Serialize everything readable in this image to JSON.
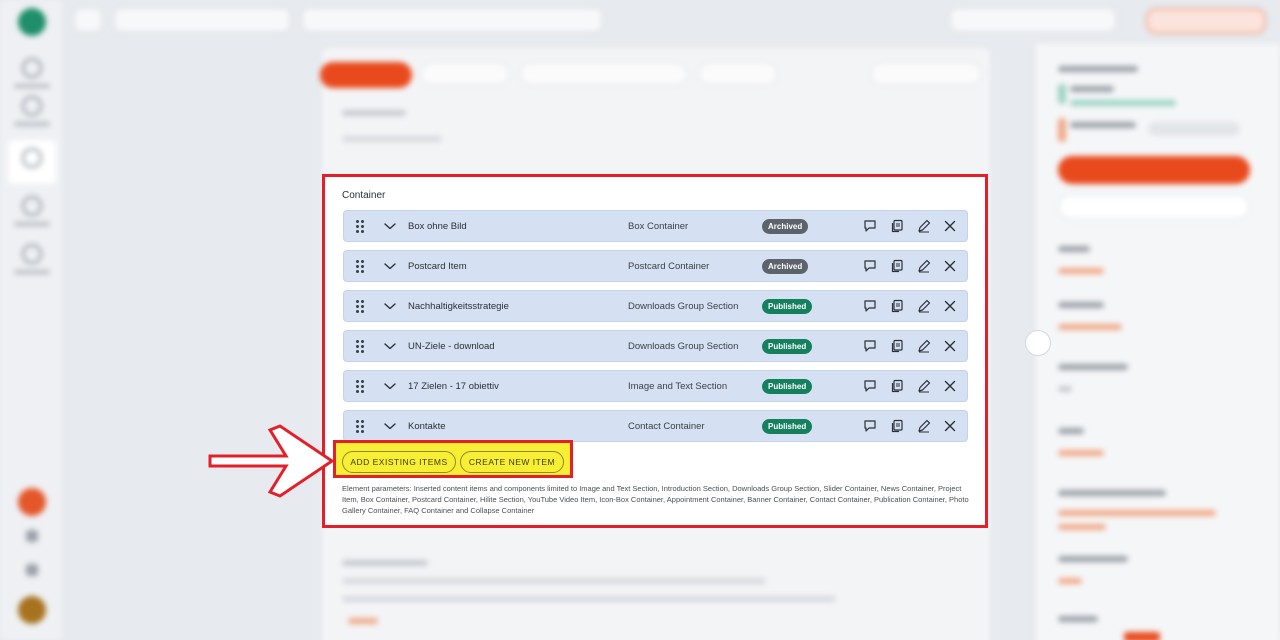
{
  "container": {
    "title": "Container",
    "items": [
      {
        "name": "Box ohne Bild",
        "type": "Box Container",
        "status": "Archived",
        "status_kind": "archived"
      },
      {
        "name": "Postcard Item",
        "type": "Postcard Container",
        "status": "Archived",
        "status_kind": "archived"
      },
      {
        "name": "Nachhaltigkeitsstrategie",
        "type": "Downloads Group Section",
        "status": "Published",
        "status_kind": "published"
      },
      {
        "name": "UN-Ziele - download",
        "type": "Downloads Group Section",
        "status": "Published",
        "status_kind": "published"
      },
      {
        "name": "17 Zielen - 17 obiettiv",
        "type": "Image and Text Section",
        "status": "Published",
        "status_kind": "published"
      },
      {
        "name": "Kontakte",
        "type": "Contact Container",
        "status": "Published",
        "status_kind": "published"
      }
    ],
    "row_actions": [
      "comment-icon",
      "copy-icon",
      "edit-icon",
      "close-icon"
    ],
    "buttons": {
      "add_existing": "ADD EXISTING ITEMS",
      "create_new": "CREATE NEW ITEM"
    },
    "element_parameters": "Element parameters: Inserted content items and components limited to Image and Text Section, Introduction Section, Downloads Group Section, Slider Container, News Container, Project Item, Box Container, Postcard Container, Hilite Section, YouTube Video Item, Icon-Box Container, Appointment Container, Banner Container, Contact Container, Publication Container, Photo Gallery Container, FAQ Container and Collapse Container"
  },
  "colors": {
    "highlight_border": "#e3202a",
    "highlight_fill": "#f8ee34",
    "row_bg": "#d5e0f2",
    "archived": "#5d636b",
    "published": "#15805e",
    "brand_red": "#e94a1d"
  }
}
